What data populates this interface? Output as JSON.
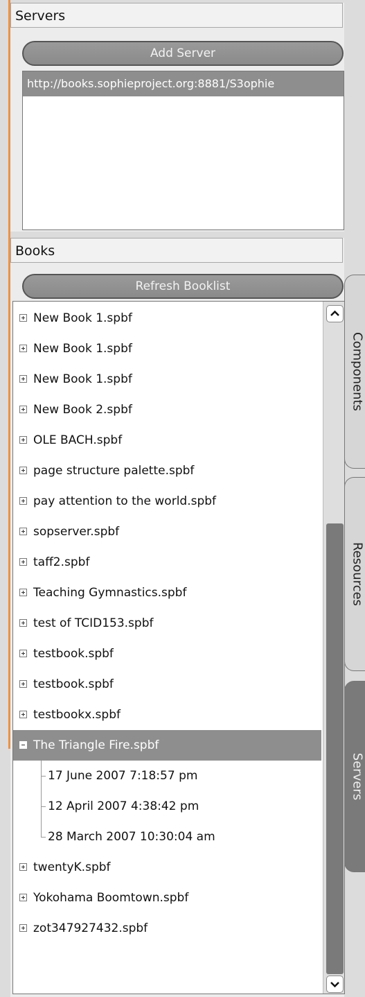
{
  "servers_panel": {
    "title": "Servers",
    "add_button": "Add Server",
    "items": [
      "http://books.sophieproject.org:8881/S3ophie"
    ]
  },
  "books_panel": {
    "title": "Books",
    "refresh_button": "Refresh Booklist",
    "items": [
      "New Book 1.spbf",
      "New Book 1.spbf",
      "New Book 1.spbf",
      "New Book 2.spbf",
      "OLE BACH.spbf",
      "page structure palette.spbf",
      "pay attention to the world.spbf",
      "sopserver.spbf",
      "taff2.spbf",
      "Teaching Gymnastics.spbf",
      "test of TCID153.spbf",
      "testbook.spbf",
      "testbook.spbf",
      "testbookx.spbf",
      "The Triangle Fire.spbf",
      "twentyK.spbf",
      "Yokohama Boomtown.spbf",
      "zot347927432.spbf"
    ],
    "expanded_children": [
      "17 June 2007 7:18:57 pm",
      "12 April 2007 4:38:42 pm",
      "28 March 2007 10:30:04 am"
    ]
  },
  "side_tabs": [
    "Components",
    "Resources",
    "Servers"
  ],
  "colors": {
    "selection": "#8e8e8e",
    "accent_strip": "#e8934a",
    "active_tab": "#7a7a7a"
  }
}
